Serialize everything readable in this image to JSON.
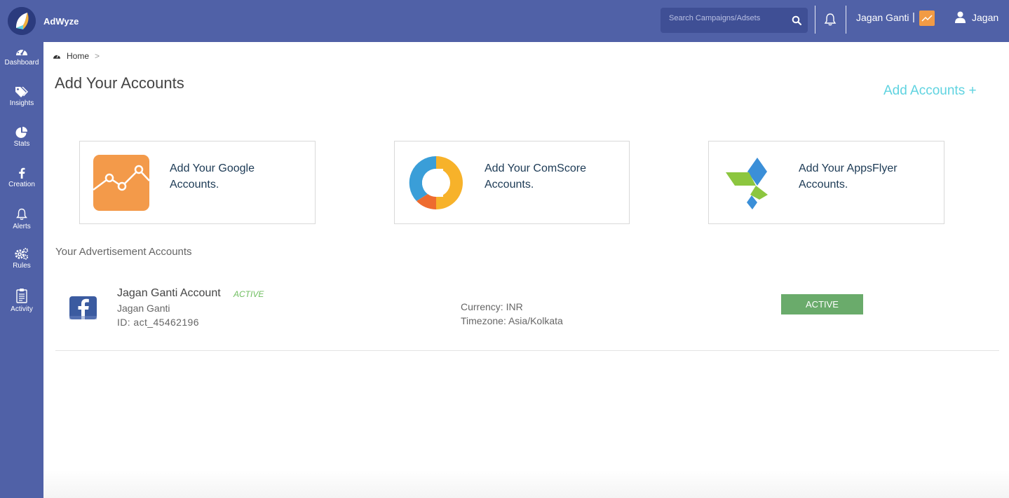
{
  "app": {
    "name": "AdWyze"
  },
  "header": {
    "search": {
      "placeholder": "Search Campaigns/Adsets",
      "value": ""
    },
    "user_name": "Jagan Ganti",
    "separator": "|",
    "profile_name": "Jagan",
    "colors": {
      "bar": "#5061a7",
      "badge": "#f29b45"
    }
  },
  "sidebar": {
    "items": [
      {
        "label": "Dashboard",
        "icon": "dashboard-icon"
      },
      {
        "label": "Insights",
        "icon": "tags-icon"
      },
      {
        "label": "Stats",
        "icon": "pie-chart-icon"
      },
      {
        "label": "Creation",
        "icon": "facebook-icon"
      },
      {
        "label": "Alerts",
        "icon": "bell-icon"
      },
      {
        "label": "Rules",
        "icon": "gears-icon"
      },
      {
        "label": "Activity",
        "icon": "clipboard-icon"
      }
    ]
  },
  "breadcrumb": {
    "home": "Home",
    "separator": ">"
  },
  "page": {
    "title": "Add Your Accounts",
    "add_accounts_link": "Add Accounts +",
    "cards": [
      {
        "text": "Add Your Google Accounts.",
        "icon": "google-analytics-icon"
      },
      {
        "text": "Add Your ComScore Accounts.",
        "icon": "comscore-icon"
      },
      {
        "text": "Add Your AppsFlyer Accounts.",
        "icon": "appsflyer-icon"
      }
    ],
    "section_title": "Your Advertisement Accounts",
    "accounts": [
      {
        "name": "Jagan Ganti Account",
        "status_tag": "ACTIVE",
        "owner": "Jagan Ganti",
        "id": "ID: act_45462196",
        "currency": "Currency: INR",
        "timezone": "Timezone: Asia/Kolkata",
        "status_button": "ACTIVE",
        "icon": "facebook-icon"
      }
    ]
  }
}
